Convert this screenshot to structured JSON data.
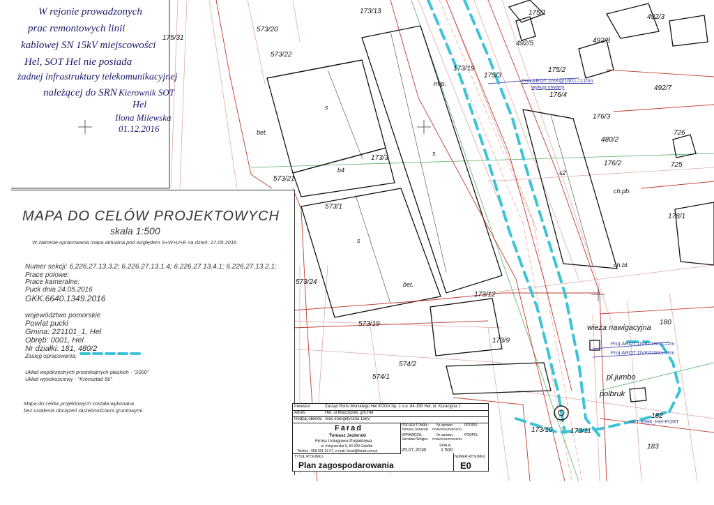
{
  "handwritten_note": {
    "lines": [
      "W rejonie prowadzonych",
      "prac remontowych linii",
      "kablowej SN 15kV miejscowości",
      "Hel, SOT Hel nie posiada",
      "żadnej infrastruktury telekomunikacyjnej",
      "należącej do SRN"
    ],
    "signature_lines": [
      "Kierownik SOT",
      "Hel",
      "Ilona Milewska",
      "01.12.2016"
    ]
  },
  "legend": {
    "title": "MAPA DO CELÓW PROJEKTOWYCH",
    "scale": "skala 1:500",
    "scope_note": "W zakresie opracowania mapa aktualna pod względem S+W+U+E na dzień: 17.05.2016",
    "section_numbers": "Numer sekcji: 6.226.27.13.3.2; 6.226.27.13.1.4; 6.226.27.13.4.1; 6.226.27.13.2.1;",
    "field_work": "Prace polowe:",
    "office_work": "Prace kameralne:",
    "place_date": "Puck dnia 24.05.2016",
    "gkk": "GKK.6640.1349.2016",
    "voivodeship": "województwo pomorskie",
    "county": "Powiat pucki",
    "commune": "Gmina: 221101_1, Hel",
    "precinct": "Obręb: 0001, Hel",
    "parcels": "Nr działki: 181, 480/2",
    "range_label": "Zasięg opracowania:",
    "coord_system": "Układ współrzędnych prostokątnych płaskich - \"2000\"",
    "height_system": "Układ wysokościowy - \"Kronsztad 86\"",
    "disclaimer_1": "Mapa do celów projektowych została wykonana",
    "disclaimer_2": "bez ustalenia obciążeń służebnościami gruntowymi."
  },
  "title_block": {
    "investor_label": "Inwestor",
    "investor": "Zarząd Portu Morskiego Hel KOGA Sp. z o.o. 84-150 Hel, ul. Kuracyjna 1",
    "address_label": "Adres",
    "address": "Hel, ul.Maszopów, gm.Hel",
    "type_label": "Rodzaj obiektu",
    "type": "Sieć energetyczna 15kV",
    "company_logo": "Farad",
    "company_owner": "Tomasz Jezierski",
    "company_name": "Firma Usługowo-Projektowa",
    "company_address": "ul. Instynierska 9, 80-298 Gdańsk",
    "company_contact": "Telefax : 058 351 16 57,   e-mail: farad@farad.com.pl",
    "designer_label": "PROJEKTOWAŁ:",
    "designer": "Tomasz Jezierski",
    "checker_label": "SPRAWDZIŁ:",
    "checker": "Jarosław Wełgus",
    "permit_label": "Nr uprawn.",
    "permit_1": "POM/0001/PWOE/01",
    "permit_2": "POM/0204/PWOE/03",
    "sign_label": "PODPIS",
    "scale_label": "SKALA",
    "scale": "1:500",
    "drawing_title_label": "TYTUŁ RYSUNKU",
    "drawing_title": "Plan zagospodarowania",
    "date": "25.07.2016",
    "drawing_no_label": "NUMER RYSUNKU",
    "drawing_no": "E0"
  },
  "map_labels": {
    "parcels": [
      "573/20",
      "573/22",
      "573/21",
      "573/1",
      "573/24",
      "573/19",
      "574/2",
      "574/1",
      "173/13",
      "173/19",
      "175/3",
      "175/1",
      "175/2",
      "176/4",
      "176/3",
      "176/2",
      "178/1",
      "173/3",
      "173/12",
      "173/9",
      "173/10",
      "173/11",
      "492/3",
      "492/8",
      "492/7",
      "492/5",
      "480/2",
      "726",
      "725",
      "180",
      "182",
      "183",
      "175/31"
    ],
    "buildings": [
      "s",
      "s",
      "s",
      "b4",
      "s2",
      "bet.",
      "bet.",
      "rmp.",
      "ch.pb.",
      "ch.bt."
    ],
    "cables": [
      "Proj.AROT DVK@160;L=110m",
      "wykop otwarty",
      "Proj.AROT DVK#160;L=2m",
      "Proj.AROT DVK#160;L=1m",
      "Ist.T-8586_Hel-PORT"
    ],
    "landmarks": [
      "wieża nawigacyjna",
      "pl.jumbo",
      "polbruk"
    ]
  },
  "colors": {
    "parcel_line": "#c0392b",
    "building": "#111111",
    "range_dash": "#3cc3d6",
    "label_blue": "#3a40a0",
    "green_text": "#2e9a4a",
    "handwriting": "#1a1a6a"
  }
}
